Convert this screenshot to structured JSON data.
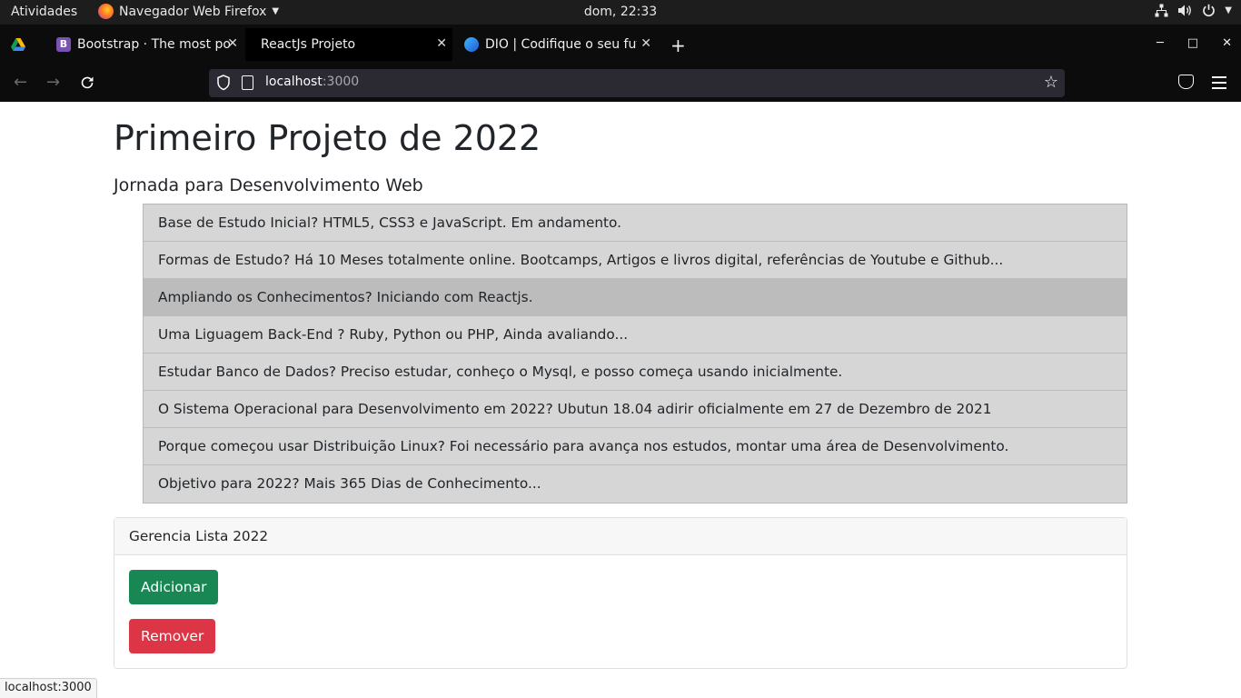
{
  "topbar": {
    "activities": "Atividades",
    "app_name": "Navegador Web Firefox",
    "clock": "dom, 22:33"
  },
  "tabs": [
    {
      "icon": "google-drive-icon",
      "label": ""
    },
    {
      "icon": "bootstrap-icon",
      "icon_letter": "B",
      "label": "Bootstrap · The most pop"
    },
    {
      "icon": "",
      "label": "ReactJs Projeto"
    },
    {
      "icon": "dio-icon",
      "label": "DIO | Codifique o seu futu"
    }
  ],
  "urlbar": {
    "host": "localhost",
    "port": ":3000"
  },
  "page": {
    "title": "Primeiro Projeto de 2022",
    "subtitle": "Jornada para Desenvolvimento Web",
    "items": [
      "Base de Estudo Inicial? HTML5, CSS3 e JavaScript. Em andamento.",
      "Formas de Estudo? Há 10 Meses totalmente online. Bootcamps, Artigos e livros digital, referências de Youtube e Github...",
      "Ampliando os Conhecimentos? Iniciando com Reactjs.",
      "Uma Liguagem Back-End ? Ruby, Python ou PHP, Ainda avaliando...",
      "Estudar Banco de Dados? Preciso estudar, conheço o Mysql, e posso começa usando inicialmente.",
      "O Sistema Operacional para Desenvolvimento em 2022? Ubutun 18.04 adirir oficialmente em 27 de Dezembro de 2021",
      "Porque começou usar Distribuição Linux? Foi necessário para avança nos estudos, montar uma área de Desenvolvimento.",
      "Objetivo para 2022? Mais 365 Dias de Conhecimento..."
    ],
    "card": {
      "header": "Gerencia Lista 2022",
      "add_label": "Adicionar",
      "remove_label": "Remover"
    }
  },
  "status_bar": "localhost:3000",
  "colors": {
    "success": "#198754",
    "danger": "#dc3545",
    "list_item_bg": "#d6d6d6",
    "list_item_hover": "#bcbcbc"
  }
}
